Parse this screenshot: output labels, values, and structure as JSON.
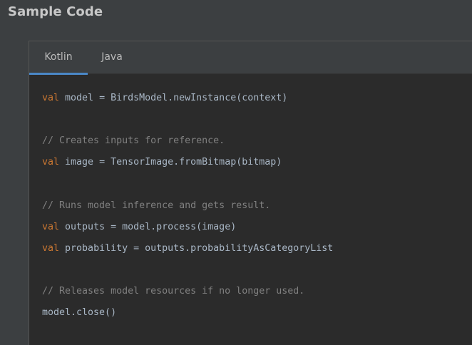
{
  "section": {
    "title": "Sample Code"
  },
  "tabs": [
    {
      "label": "Kotlin",
      "selected": true
    },
    {
      "label": "Java",
      "selected": false
    }
  ],
  "colors": {
    "keyword": "#cc7832",
    "comment": "#808080",
    "text": "#a9b7c6",
    "accent": "#4a88c7"
  },
  "code": {
    "line1_kw": "val",
    "line1_rest": " model = BirdsModel.newInstance(context)",
    "line2_comment": "// Creates inputs for reference.",
    "line3_kw": "val",
    "line3_rest": " image = TensorImage.fromBitmap(bitmap)",
    "line4_comment": "// Runs model inference and gets result.",
    "line5_kw": "val",
    "line5_rest": " outputs = model.process(image)",
    "line6_kw": "val",
    "line6_rest": " probability = outputs.probabilityAsCategoryList",
    "line7_comment": "// Releases model resources if no longer used.",
    "line8_text": "model.close()"
  }
}
